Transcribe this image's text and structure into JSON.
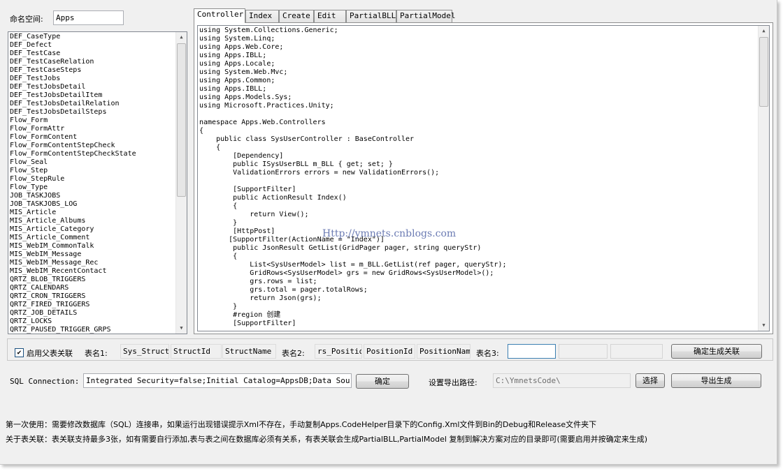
{
  "namespace": {
    "label": "命名空间:",
    "value": "Apps"
  },
  "tables": [
    "DEF_CaseType",
    "DEF_Defect",
    "DEF_TestCase",
    "DEF_TestCaseRelation",
    "DEF_TestCaseSteps",
    "DEF_TestJobs",
    "DEF_TestJobsDetail",
    "DEF_TestJobsDetailItem",
    "DEF_TestJobsDetailRelation",
    "DEF_TestJobsDetailSteps",
    "Flow_Form",
    "Flow_FormAttr",
    "Flow_FormContent",
    "Flow_FormContentStepCheck",
    "Flow_FormContentStepCheckState",
    "Flow_Seal",
    "Flow_Step",
    "Flow_StepRule",
    "Flow_Type",
    "JOB_TASKJOBS",
    "JOB_TASKJOBS_LOG",
    "MIS_Article",
    "MIS_Article_Albums",
    "MIS_Article_Category",
    "MIS_Article_Comment",
    "MIS_WebIM_CommonTalk",
    "MIS_WebIM_Message",
    "MIS_WebIM_Message_Rec",
    "MIS_WebIM_RecentContact",
    "QRTZ_BLOB_TRIGGERS",
    "QRTZ_CALENDARS",
    "QRTZ_CRON_TRIGGERS",
    "QRTZ_FIRED_TRIGGERS",
    "QRTZ_JOB_DETAILS",
    "QRTZ_LOCKS",
    "QRTZ_PAUSED_TRIGGER_GRPS"
  ],
  "tabs": [
    "Controller",
    "Index",
    "Create",
    "Edit",
    "PartialBLL",
    "PartialModel"
  ],
  "code": "using System.Collections.Generic;\nusing System.Linq;\nusing Apps.Web.Core;\nusing Apps.IBLL;\nusing Apps.Locale;\nusing System.Web.Mvc;\nusing Apps.Common;\nusing Apps.IBLL;\nusing Apps.Models.Sys;\nusing Microsoft.Practices.Unity;\n\nnamespace Apps.Web.Controllers\n{\n    public class SysUserController : BaseController\n    {\n        [Dependency]\n        public ISysUserBLL m_BLL { get; set; }\n        ValidationErrors errors = new ValidationErrors();\n\n        [SupportFilter]\n        public ActionResult Index()\n        {\n            return View();\n        }\n        [HttpPost]\n       [SupportFilter(ActionName = \"Index\")]\n        public JsonResult GetList(GridPager pager, string queryStr)\n        {\n            List<SysUserModel> list = m_BLL.GetList(ref pager, queryStr);\n            GridRows<SysUserModel> grs = new GridRows<SysUserModel>();\n            grs.rows = list;\n            grs.total = pager.totalRows;\n            return Json(grs);\n        }\n        #region 创建\n        [SupportFilter]",
  "watermark": "Http://ymnets.cnblogs.com",
  "relation": {
    "checkbox_label": "启用父表关联",
    "checked": true,
    "table1_label": "表名1:",
    "table1": [
      "Sys_Struct",
      "StructId",
      "StructName"
    ],
    "table2_label": "表名2:",
    "table2": [
      "rs_Position",
      "PositionId",
      "PositionName"
    ],
    "table3_label": "表名3:",
    "table3": [
      "",
      "",
      ""
    ],
    "confirm_button": "确定生成关联"
  },
  "sql": {
    "label": "SQL Connection:",
    "value": "Integrated Security=false;Initial Catalog=AppsDB;Data Source=.;",
    "confirm_button": "确定"
  },
  "export": {
    "label": "设置导出路径:",
    "path": "C:\\YmnetsCode\\",
    "choose_button": "选择",
    "export_button": "导出生成"
  },
  "notes": [
    "第一次使用：需要修改数据库（SQL）连接串，如果运行出现错误提示Xml不存在，手动复制Apps.CodeHelper目录下的Config.Xml文件到Bin的Debug和Release文件夹下",
    "关于表关联：表关联支持最多3张，如有需要自行添加,表与表之间在数据库必须有关系，有表关联会生成PartialBLL,PartialModel 复制到解决方案对应的目录即可(需要启用并按确定来生成)"
  ]
}
